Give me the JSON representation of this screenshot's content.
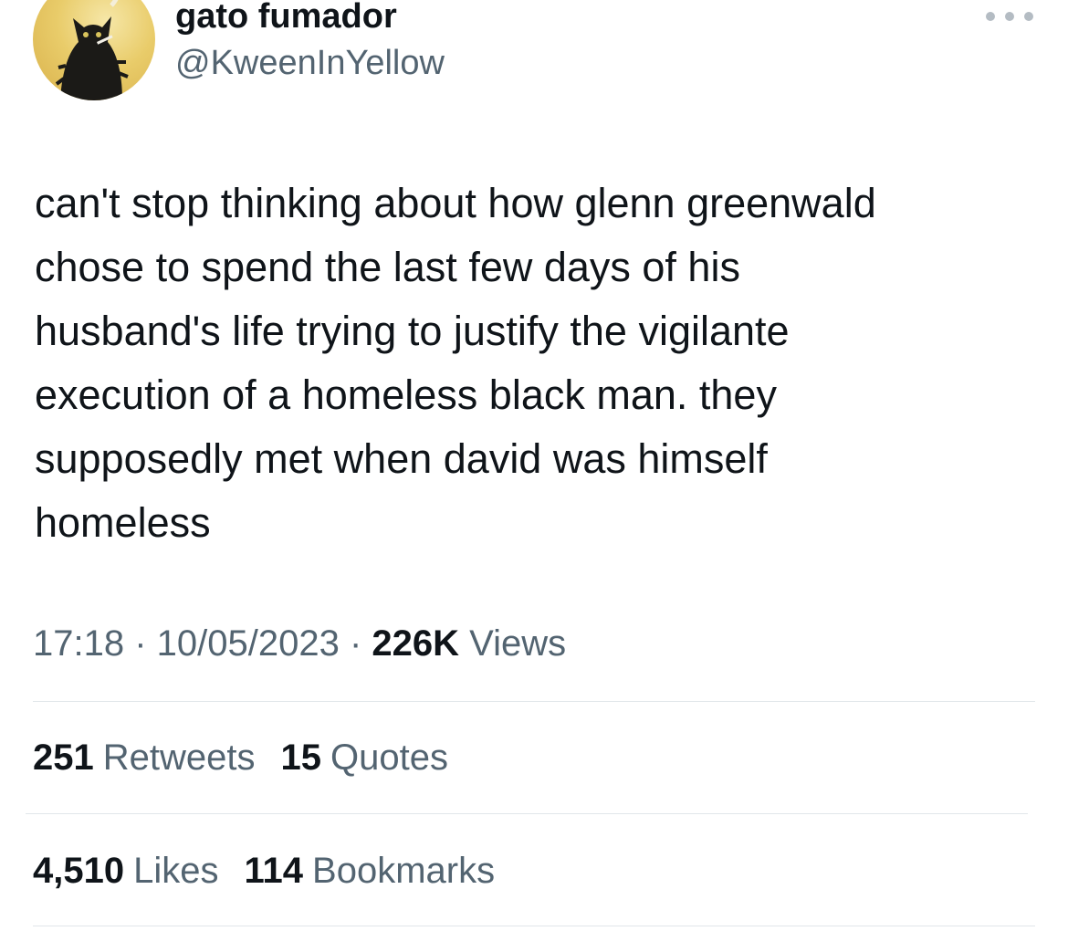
{
  "user": {
    "display_name": "gato fumador",
    "handle": "@KweenInYellow",
    "avatar_icon": "black-cat-smoking-avatar"
  },
  "menu": {
    "icon": "more-horizontal-icon"
  },
  "tweet": {
    "lines": [
      "can't stop thinking about how glenn greenwald",
      "chose to spend the last few days of his",
      "husband's life trying to justify the vigilante",
      "execution of a homeless black man. they",
      "supposedly met when david was himself",
      "homeless"
    ]
  },
  "meta": {
    "time": "17:18",
    "separator": " · ",
    "date": "10/05/2023",
    "views_count": "226K",
    "views_label": "Views"
  },
  "stats": {
    "retweets_count": "251",
    "retweets_label": "Retweets",
    "quotes_count": "15",
    "quotes_label": "Quotes",
    "likes_count": "4,510",
    "likes_label": "Likes",
    "bookmarks_count": "114",
    "bookmarks_label": "Bookmarks"
  },
  "colors": {
    "text_primary": "#0f1419",
    "text_secondary": "#536471",
    "divider": "#e1e6ea"
  }
}
